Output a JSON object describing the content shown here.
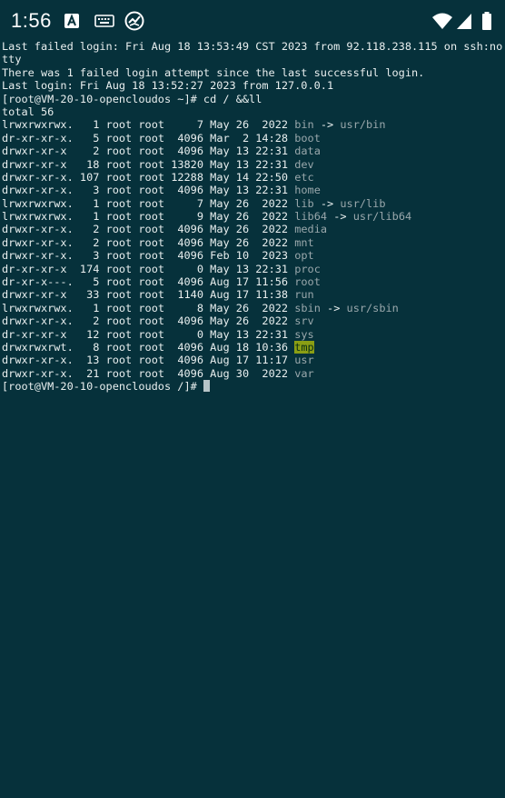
{
  "status_bar": {
    "time": "1:56",
    "icons": [
      "app-a-icon",
      "keyboard-icon",
      "cloud-sync-icon",
      "wifi-icon",
      "cellular-signal-icon",
      "battery-icon"
    ]
  },
  "terminal": {
    "header_lines": [
      "Last failed login: Fri Aug 18 13:53:49 CST 2023 from 92.118.238.115 on ssh:no",
      "tty",
      "There was 1 failed login attempt since the last successful login.",
      "Last login: Fri Aug 18 13:52:27 2023 from 127.0.0.1",
      "[root@VM-20-10-opencloudos ~]# cd / &&ll",
      "total 56"
    ],
    "entries": [
      {
        "perm": "lrwxrwxrwx. ",
        "links": "  1",
        "owner": "root",
        "group": "root",
        "size": "    7",
        "date": "May 26  2022",
        "name": "bin",
        "type": "link",
        "target": "usr/bin"
      },
      {
        "perm": "dr-xr-xr-x. ",
        "links": "  5",
        "owner": "root",
        "group": "root",
        "size": " 4096",
        "date": "Mar  2 14:28",
        "name": "boot",
        "type": "dir",
        "target": ""
      },
      {
        "perm": "drwxr-xr-x  ",
        "links": "  2",
        "owner": "root",
        "group": "root",
        "size": " 4096",
        "date": "May 13 22:31",
        "name": "data",
        "type": "dir",
        "target": ""
      },
      {
        "perm": "drwxr-xr-x  ",
        "links": " 18",
        "owner": "root",
        "group": "root",
        "size": "13820",
        "date": "May 13 22:31",
        "name": "dev",
        "type": "dir",
        "target": ""
      },
      {
        "perm": "drwxr-xr-x. ",
        "links": "107",
        "owner": "root",
        "group": "root",
        "size": "12288",
        "date": "May 14 22:50",
        "name": "etc",
        "type": "dir",
        "target": ""
      },
      {
        "perm": "drwxr-xr-x. ",
        "links": "  3",
        "owner": "root",
        "group": "root",
        "size": " 4096",
        "date": "May 13 22:31",
        "name": "home",
        "type": "dir",
        "target": ""
      },
      {
        "perm": "lrwxrwxrwx. ",
        "links": "  1",
        "owner": "root",
        "group": "root",
        "size": "    7",
        "date": "May 26  2022",
        "name": "lib",
        "type": "link",
        "target": "usr/lib"
      },
      {
        "perm": "lrwxrwxrwx. ",
        "links": "  1",
        "owner": "root",
        "group": "root",
        "size": "    9",
        "date": "May 26  2022",
        "name": "lib64",
        "type": "link",
        "target": "usr/lib64"
      },
      {
        "perm": "drwxr-xr-x. ",
        "links": "  2",
        "owner": "root",
        "group": "root",
        "size": " 4096",
        "date": "May 26  2022",
        "name": "media",
        "type": "dir",
        "target": ""
      },
      {
        "perm": "drwxr-xr-x. ",
        "links": "  2",
        "owner": "root",
        "group": "root",
        "size": " 4096",
        "date": "May 26  2022",
        "name": "mnt",
        "type": "dir",
        "target": ""
      },
      {
        "perm": "drwxr-xr-x. ",
        "links": "  3",
        "owner": "root",
        "group": "root",
        "size": " 4096",
        "date": "Feb 10  2023",
        "name": "opt",
        "type": "dir",
        "target": ""
      },
      {
        "perm": "dr-xr-xr-x  ",
        "links": "174",
        "owner": "root",
        "group": "root",
        "size": "    0",
        "date": "May 13 22:31",
        "name": "proc",
        "type": "dir",
        "target": ""
      },
      {
        "perm": "dr-xr-x---. ",
        "links": "  5",
        "owner": "root",
        "group": "root",
        "size": " 4096",
        "date": "Aug 17 11:56",
        "name": "root",
        "type": "dir",
        "target": ""
      },
      {
        "perm": "drwxr-xr-x  ",
        "links": " 33",
        "owner": "root",
        "group": "root",
        "size": " 1140",
        "date": "Aug 17 11:38",
        "name": "run",
        "type": "dir",
        "target": ""
      },
      {
        "perm": "lrwxrwxrwx. ",
        "links": "  1",
        "owner": "root",
        "group": "root",
        "size": "    8",
        "date": "May 26  2022",
        "name": "sbin",
        "type": "link",
        "target": "usr/sbin"
      },
      {
        "perm": "drwxr-xr-x. ",
        "links": "  2",
        "owner": "root",
        "group": "root",
        "size": " 4096",
        "date": "May 26  2022",
        "name": "srv",
        "type": "dir",
        "target": ""
      },
      {
        "perm": "dr-xr-xr-x  ",
        "links": " 12",
        "owner": "root",
        "group": "root",
        "size": "    0",
        "date": "May 13 22:31",
        "name": "sys",
        "type": "dir",
        "target": ""
      },
      {
        "perm": "drwxrwxrwt. ",
        "links": "  8",
        "owner": "root",
        "group": "root",
        "size": " 4096",
        "date": "Aug 18 10:36",
        "name": "tmp",
        "type": "sticky",
        "target": ""
      },
      {
        "perm": "drwxr-xr-x. ",
        "links": " 13",
        "owner": "root",
        "group": "root",
        "size": " 4096",
        "date": "Aug 17 11:17",
        "name": "usr",
        "type": "dir",
        "target": ""
      },
      {
        "perm": "drwxr-xr-x. ",
        "links": " 21",
        "owner": "root",
        "group": "root",
        "size": " 4096",
        "date": "Aug 30  2022",
        "name": "var",
        "type": "dir",
        "target": ""
      }
    ],
    "prompt": "[root@VM-20-10-opencloudos /]# ",
    "arrow": "->"
  },
  "colors": {
    "background": "#06313b",
    "dir_name": "#9aa8ac",
    "sticky_bg": "#8a9e14"
  }
}
